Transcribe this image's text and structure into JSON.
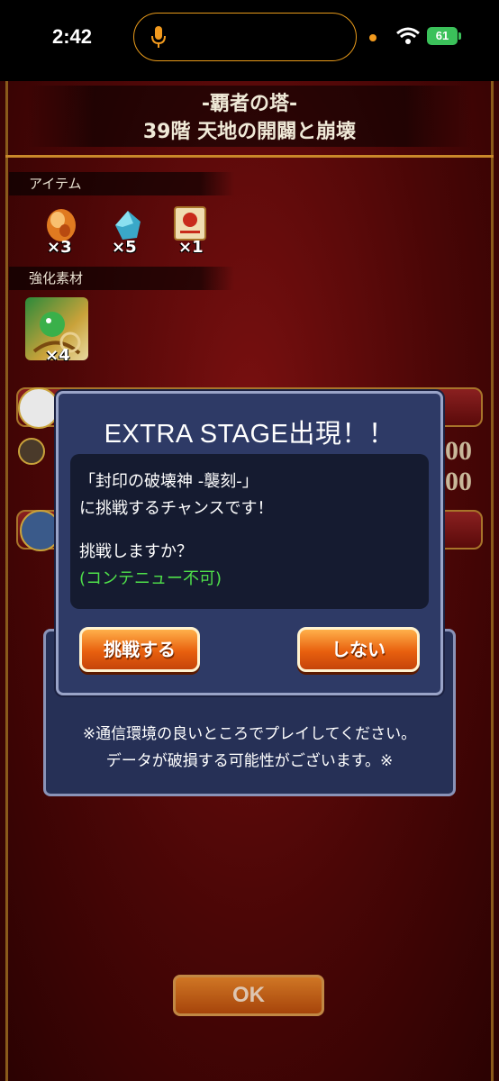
{
  "status_bar": {
    "time": "2:42",
    "battery": "61",
    "accent_color": "#f29a1e"
  },
  "header": {
    "tower_name": "-覇者の塔-",
    "stage_title": "39階 天地の開闢と崩壊"
  },
  "rewards": {
    "items_label": "アイテム",
    "items": [
      {
        "icon": "orange-orb-icon",
        "count": "×3"
      },
      {
        "icon": "blue-crystal-icon",
        "count": "×5"
      },
      {
        "icon": "scroll-icon",
        "count": "×1"
      }
    ],
    "materials_label": "強化素材",
    "materials": [
      {
        "icon": "monster-material-icon",
        "count": "×4"
      }
    ]
  },
  "background_values": {
    "value_1": "00",
    "value_2": "00"
  },
  "popup": {
    "title": "EXTRA STAGE出現！！",
    "line1": "「封印の破壊神 -襲刻-」",
    "line2": "に挑戦するチャンスです！",
    "line3": "挑戦しますか？",
    "note": "(コンテニュー不可)",
    "note_color": "#4fe04a",
    "yes_label": "挑戦する",
    "no_label": "しない"
  },
  "notice": {
    "line1": "※通信環境の良いところでプレイしてください。",
    "line2": "データが破損する可能性がございます。※"
  },
  "footer": {
    "ok_label": "OK"
  }
}
